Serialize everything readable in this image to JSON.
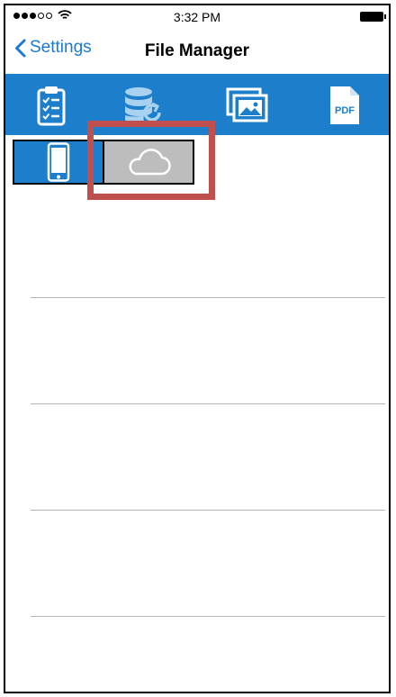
{
  "status_bar": {
    "time": "3:32 PM",
    "signal_dots_filled": 3,
    "signal_dots_total": 5,
    "wifi_icon": "wifi-icon",
    "battery_icon": "battery-icon"
  },
  "nav": {
    "back_label": "Settings",
    "title": "File Manager"
  },
  "toolbar": {
    "items": [
      {
        "icon": "clipboard-checklist-icon"
      },
      {
        "icon": "database-sync-icon"
      },
      {
        "icon": "images-icon"
      },
      {
        "icon": "pdf-file-icon",
        "text": "PDF"
      }
    ]
  },
  "segments": [
    {
      "icon": "phone-icon",
      "selected": true
    },
    {
      "icon": "cloud-icon",
      "selected": false
    }
  ],
  "list": {
    "row_count": 4,
    "rows": [
      "",
      "",
      "",
      ""
    ]
  },
  "colors": {
    "accent": "#1d7fcb",
    "link": "#1a7ad6",
    "highlight": "#c0504d",
    "segment_inactive": "#bdbdbd",
    "divider": "#b3b3b3"
  }
}
